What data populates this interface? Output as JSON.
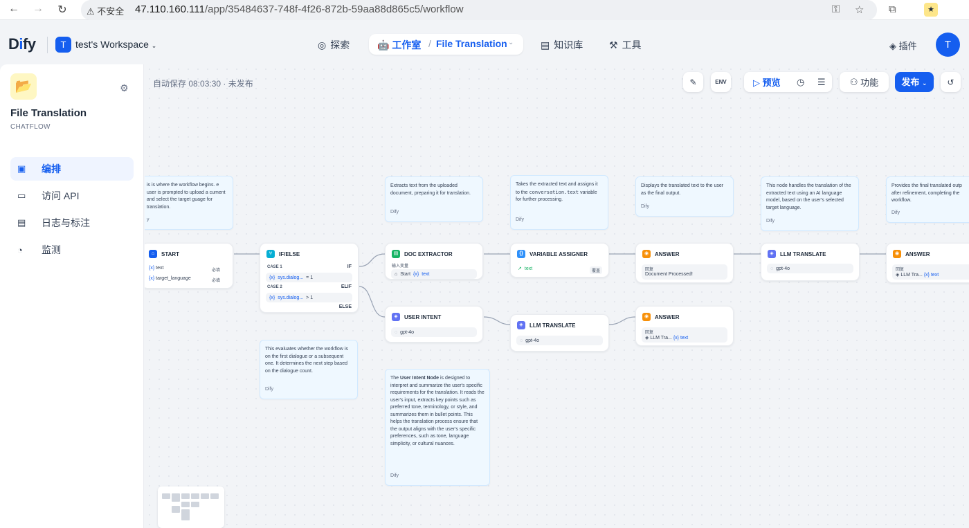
{
  "browser": {
    "security_label": "不安全",
    "url_host": "47.110.160.111",
    "url_path": "/app/35484637-748f-4f26-872b-59aa88d865c5/workflow"
  },
  "header": {
    "logo_text": "Dify",
    "workspace_initial": "T",
    "workspace_name": "test's Workspace",
    "nav_explore": "探索",
    "nav_studio": "工作室",
    "current_app": "File Translation",
    "nav_knowledge": "知识库",
    "nav_tools": "工具",
    "plugins": "插件",
    "user_initial": "T"
  },
  "sidebar": {
    "app_name": "File Translation",
    "app_type": "CHATFLOW",
    "items": [
      {
        "label": "编排",
        "icon": "orchestrate-icon"
      },
      {
        "label": "访问 API",
        "icon": "api-icon"
      },
      {
        "label": "日志与标注",
        "icon": "logs-icon"
      },
      {
        "label": "监测",
        "icon": "monitor-icon"
      }
    ]
  },
  "toolbar": {
    "autosave": "自动保存 08:03:30 · 未发布",
    "env_label": "ENV",
    "preview": "预览",
    "features": "功能",
    "publish": "发布"
  },
  "notes": {
    "start": "is is where the workflow begins. e user is prompted to upload a cument and select the target guage for translation.",
    "start_author": "y",
    "doc": "Extracts text from the uploaded document, preparing it for translation.",
    "assigner_a": "Takes the extracted text and assigns it to the",
    "assigner_code": "conversation.text",
    "assigner_b": "variable for further processing.",
    "answer": "Displays the translated text to the user as the final output.",
    "llm": "This node handles the translation of the extracted text using an AI language model, based on the user's selected target language.",
    "final": "Provides the final translated outp after refinement, completing the workflow.",
    "ifelse": "This evaluates whether the workflow is on the first dialogue or a subsequent one. It determines the next step based on the dialogue count.",
    "intent_a": "The",
    "intent_bold": "User Intent Node",
    "intent_b": "is designed to interpret and summarize the user's specific requirements for the translation. It reads the user's input, extracts key points such as preferred tone, terminology, or style, and summarizes them in bullet points. This helps the translation process ensure that the output aligns with the user's specific preferences, such as tone, language simplicity, or cultural nuances.",
    "author": "Dify"
  },
  "nodes": {
    "start": {
      "title": "START",
      "var1": "text",
      "var2": "target_language",
      "req": "必填"
    },
    "ifelse": {
      "title": "IF/ELSE",
      "case1": "CASE 1",
      "if": "IF",
      "cond1_var": "sys.dialog...",
      "cond1_op": "= 1",
      "case2": "CASE 2",
      "elif": "ELIF",
      "cond2_var": "sys.dialog...",
      "cond2_op": "> 1",
      "else": "ELSE"
    },
    "doc": {
      "title": "DOC EXTRACTOR",
      "input_label": "输入变量",
      "src": "Start",
      "var": "text"
    },
    "assigner": {
      "title": "VARIABLE ASSIGNER",
      "var": "text",
      "mode": "覆盖"
    },
    "answer1": {
      "title": "ANSWER",
      "label": "回复",
      "text": "Document Processed!"
    },
    "llm1": {
      "title": "LLM TRANSLATE",
      "model": "gpt-4o"
    },
    "answer2": {
      "title": "ANSWER",
      "label": "回复",
      "src": "LLM Tra...",
      "var": "text"
    },
    "intent": {
      "title": "USER INTENT",
      "model": "gpt-4o"
    },
    "llm2": {
      "title": "LLM TRANSLATE",
      "model": "gpt-4o"
    },
    "answer3": {
      "title": "ANSWER",
      "label": "回复",
      "src": "LLM Tra...",
      "var": "text"
    }
  },
  "colors": {
    "accent": "#155eef",
    "start": "#155eef",
    "ifelse": "#06aed4",
    "doc": "#16b364",
    "assigner": "#2e90fa",
    "answer": "#f79009",
    "llm": "#6172f3"
  }
}
